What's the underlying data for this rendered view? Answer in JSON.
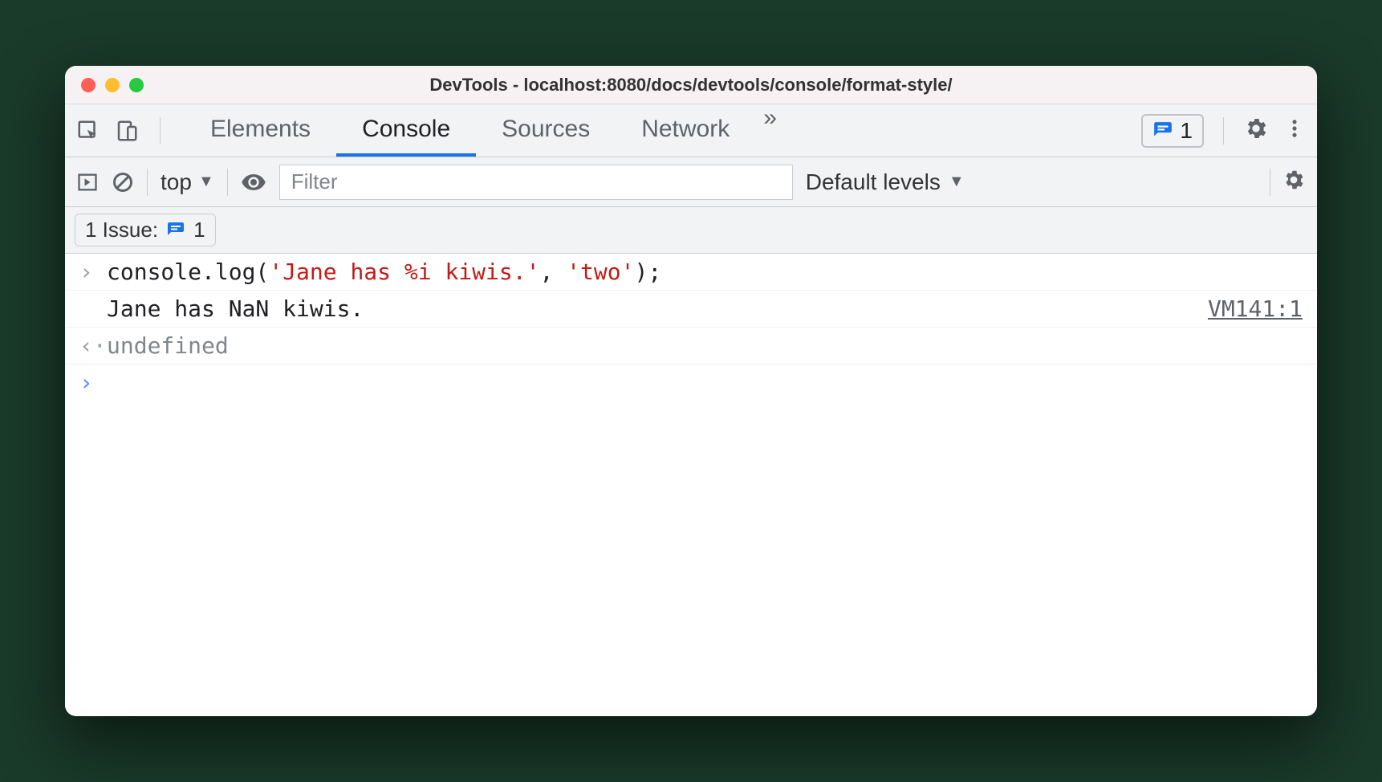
{
  "window": {
    "title": "DevTools - localhost:8080/docs/devtools/console/format-style/"
  },
  "tabs": {
    "items": [
      "Elements",
      "Console",
      "Sources",
      "Network"
    ],
    "active_index": 1,
    "more_glyph": "»",
    "issues_count": "1"
  },
  "toolbar": {
    "context": "top",
    "filter_placeholder": "Filter",
    "levels_label": "Default levels"
  },
  "issues_bar": {
    "label": "1 Issue:",
    "count": "1"
  },
  "console_rows": {
    "input": {
      "prefix": "console.log(",
      "str1": "'Jane has %i kiwis.'",
      "sep": ", ",
      "str2": "'two'",
      "suffix": ");"
    },
    "output": {
      "text": "Jane has NaN kiwis.",
      "source": "VM141:1"
    },
    "return": {
      "text": "undefined"
    }
  }
}
